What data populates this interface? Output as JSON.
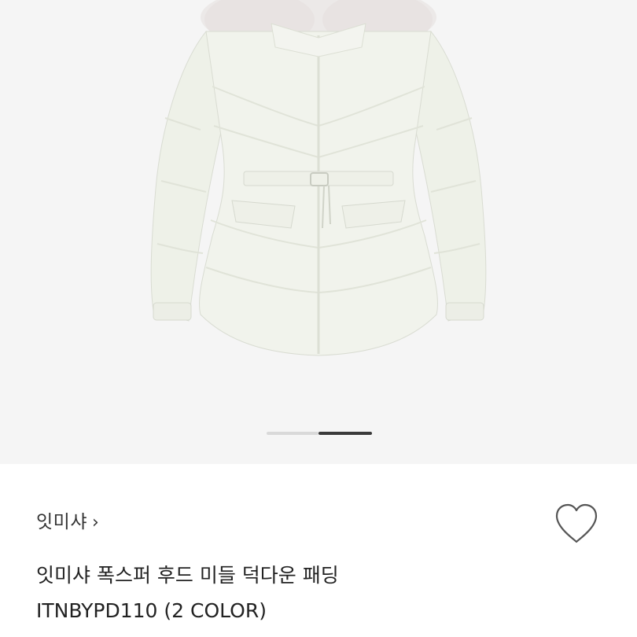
{
  "product_image": {
    "icon": "white-down-padding-jacket-with-fur-hood",
    "carousel": {
      "total_slides": 2,
      "active_index": 1
    }
  },
  "brand": {
    "name": "잇미샤",
    "chevron": "›"
  },
  "wishlist": {
    "icon": "heart-outline-icon"
  },
  "product": {
    "name": "잇미샤 폭스퍼 후드 미들 덕다운 패딩",
    "code": "ITNBYPD110 (2 COLOR)"
  },
  "colors": {
    "hero_bg": "#f5f5f5",
    "active_dot": "#3a3a3a",
    "inactive_dot": "#d9d9d9",
    "text": "#222222"
  }
}
